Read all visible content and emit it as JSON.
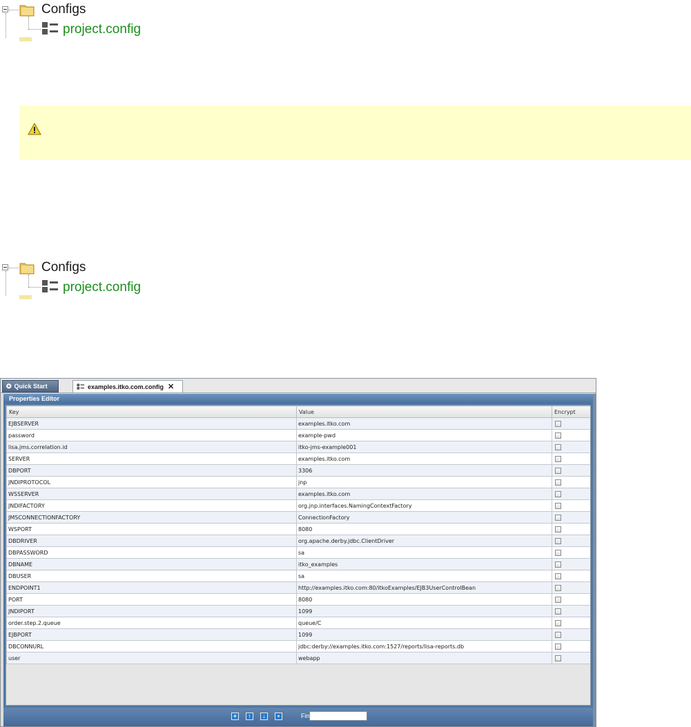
{
  "tree_top": {
    "folder_label": "Configs",
    "file_label": "project.config"
  },
  "tree_bottom": {
    "folder_label": "Configs",
    "file_label": "project.config"
  },
  "warning": {
    "icon": "warning-triangle-icon",
    "text": ""
  },
  "editor": {
    "tabs": [
      {
        "label": "Quick Start",
        "icon": "quick-start-icon"
      },
      {
        "label": "examples.itko.com.config",
        "icon": "config-file-icon",
        "close": "✕"
      }
    ],
    "panel_title": "Properties Editor",
    "columns": [
      "Key",
      "Value",
      "Encrypt"
    ],
    "rows": [
      {
        "key": "EJBSERVER",
        "value": "examples.itko.com"
      },
      {
        "key": "password",
        "value": "example-pwd"
      },
      {
        "key": "lisa.jms.correlation.id",
        "value": "itko-jms-example001"
      },
      {
        "key": "SERVER",
        "value": "examples.itko.com"
      },
      {
        "key": "DBPORT",
        "value": "3306"
      },
      {
        "key": "JNDIPROTOCOL",
        "value": "jnp"
      },
      {
        "key": "WSSERVER",
        "value": "examples.itko.com"
      },
      {
        "key": "JNDIFACTORY",
        "value": "org.jnp.interfaces.NamingContextFactory"
      },
      {
        "key": "JMSCONNECTIONFACTORY",
        "value": "ConnectionFactory"
      },
      {
        "key": "WSPORT",
        "value": "8080"
      },
      {
        "key": "DBDRIVER",
        "value": "org.apache.derby.jdbc.ClientDriver"
      },
      {
        "key": "DBPASSWORD",
        "value": "sa"
      },
      {
        "key": "DBNAME",
        "value": "itko_examples"
      },
      {
        "key": "DBUSER",
        "value": "sa"
      },
      {
        "key": "ENDPOINT1",
        "value": "http://examples.itko.com:80/itkoExamples/EJB3UserControlBean"
      },
      {
        "key": "PORT",
        "value": "8080"
      },
      {
        "key": "JNDIPORT",
        "value": "1099"
      },
      {
        "key": "order.step.2.queue",
        "value": "queue/C"
      },
      {
        "key": "EJBPORT",
        "value": "1099"
      },
      {
        "key": "DBCONNURL",
        "value": "jdbc:derby://examples.itko.com:1527/reports/lisa-reports.db"
      },
      {
        "key": "user",
        "value": "webapp"
      }
    ],
    "footer": {
      "buttons": [
        {
          "name": "add-row-button",
          "glyph": "+"
        },
        {
          "name": "move-up-button",
          "glyph": "↑"
        },
        {
          "name": "move-down-button",
          "glyph": "↓"
        },
        {
          "name": "delete-row-button",
          "glyph": "▪"
        }
      ],
      "find_label": "Find:",
      "find_value": ""
    }
  }
}
